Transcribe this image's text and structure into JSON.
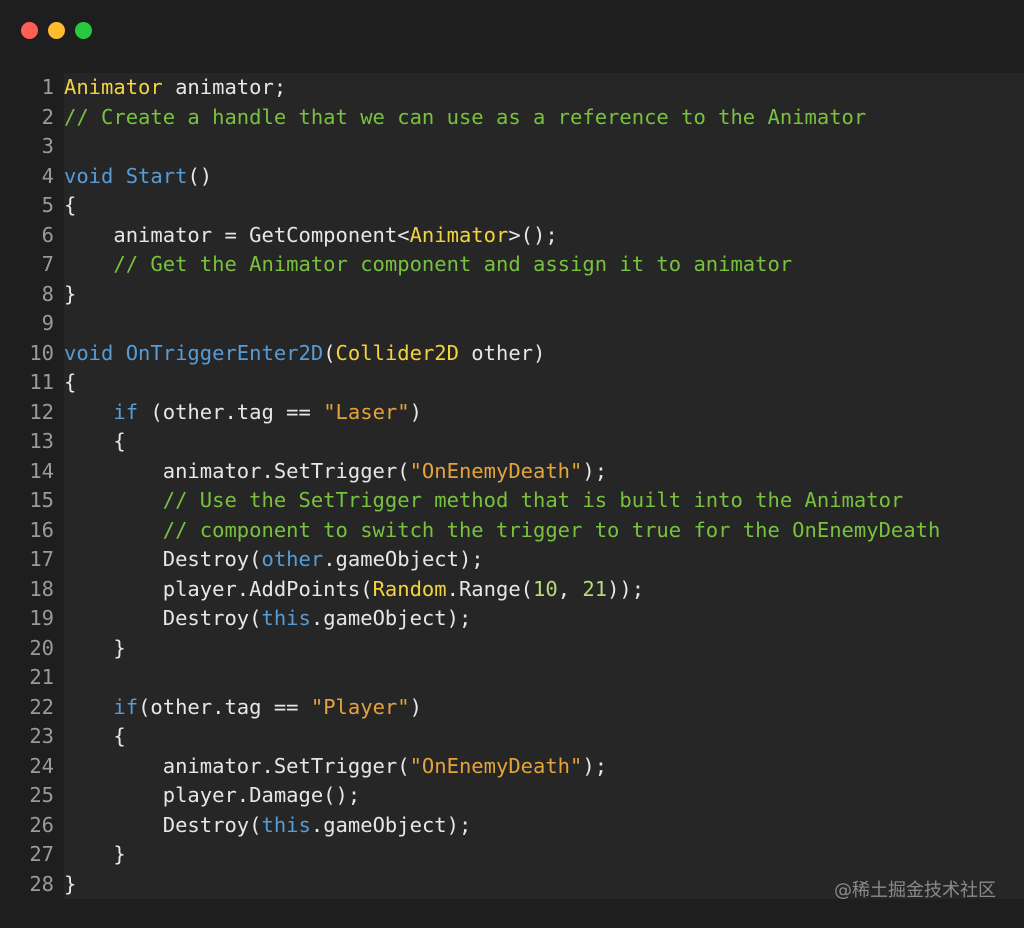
{
  "window": {
    "buttons": [
      "close",
      "minimize",
      "maximize"
    ],
    "colors": {
      "close": "#ff5f57",
      "minimize": "#febc2e",
      "maximize": "#28c840",
      "background": "#1e1e1e"
    }
  },
  "watermark": "@稀土掘金技术社区",
  "code_lines": [
    {
      "n": "1",
      "tokens": [
        [
          "ty",
          "Animator"
        ],
        [
          "pl",
          " animator;"
        ]
      ]
    },
    {
      "n": "2",
      "tokens": [
        [
          "cm",
          "// Create a handle that we can use as a reference to the Animator"
        ]
      ]
    },
    {
      "n": "3",
      "tokens": []
    },
    {
      "n": "4",
      "tokens": [
        [
          "kw",
          "void"
        ],
        [
          "pl",
          " "
        ],
        [
          "fn",
          "Start"
        ],
        [
          "pl",
          "()"
        ]
      ]
    },
    {
      "n": "5",
      "tokens": [
        [
          "pl",
          "{"
        ]
      ]
    },
    {
      "n": "6",
      "tokens": [
        [
          "pl",
          "    animator = GetComponent<"
        ],
        [
          "ty",
          "Animator"
        ],
        [
          "pl",
          ">();"
        ]
      ]
    },
    {
      "n": "7",
      "tokens": [
        [
          "cm",
          "    // Get the Animator component and assign it to animator"
        ]
      ]
    },
    {
      "n": "8",
      "tokens": [
        [
          "pl",
          "}"
        ]
      ]
    },
    {
      "n": "9",
      "tokens": []
    },
    {
      "n": "10",
      "tokens": [
        [
          "kw",
          "void"
        ],
        [
          "pl",
          " "
        ],
        [
          "fn",
          "OnTriggerEnter2D"
        ],
        [
          "pl",
          "("
        ],
        [
          "ty",
          "Collider2D"
        ],
        [
          "pl",
          " other)"
        ]
      ]
    },
    {
      "n": "11",
      "tokens": [
        [
          "pl",
          "{"
        ]
      ]
    },
    {
      "n": "12",
      "tokens": [
        [
          "pl",
          "    "
        ],
        [
          "kw",
          "if"
        ],
        [
          "pl",
          " (other.tag == "
        ],
        [
          "str",
          "\"Laser\""
        ],
        [
          "pl",
          ")"
        ]
      ]
    },
    {
      "n": "13",
      "tokens": [
        [
          "pl",
          "    {"
        ]
      ]
    },
    {
      "n": "14",
      "tokens": [
        [
          "pl",
          "        animator.SetTrigger("
        ],
        [
          "str",
          "\"OnEnemyDeath\""
        ],
        [
          "pl",
          ");"
        ]
      ]
    },
    {
      "n": "15",
      "tokens": [
        [
          "cm",
          "        // Use the SetTrigger method that is built into the Animator"
        ]
      ]
    },
    {
      "n": "16",
      "tokens": [
        [
          "cm",
          "        // component to switch the trigger to true for the OnEnemyDeath"
        ]
      ]
    },
    {
      "n": "17",
      "tokens": [
        [
          "pl",
          "        Destroy("
        ],
        [
          "kw",
          "other"
        ],
        [
          "pl",
          ".gameObject);"
        ]
      ]
    },
    {
      "n": "18",
      "tokens": [
        [
          "pl",
          "        player.AddPoints("
        ],
        [
          "ty",
          "Random"
        ],
        [
          "pl",
          ".Range("
        ],
        [
          "num",
          "10"
        ],
        [
          "pl",
          ", "
        ],
        [
          "num",
          "21"
        ],
        [
          "pl",
          "));"
        ]
      ]
    },
    {
      "n": "19",
      "tokens": [
        [
          "pl",
          "        Destroy("
        ],
        [
          "kw",
          "this"
        ],
        [
          "pl",
          ".gameObject);"
        ]
      ]
    },
    {
      "n": "20",
      "tokens": [
        [
          "pl",
          "    }"
        ]
      ]
    },
    {
      "n": "21",
      "tokens": []
    },
    {
      "n": "22",
      "tokens": [
        [
          "pl",
          "    "
        ],
        [
          "kw",
          "if"
        ],
        [
          "pl",
          "(other.tag == "
        ],
        [
          "str",
          "\"Player\""
        ],
        [
          "pl",
          ")"
        ]
      ]
    },
    {
      "n": "23",
      "tokens": [
        [
          "pl",
          "    {"
        ]
      ]
    },
    {
      "n": "24",
      "tokens": [
        [
          "pl",
          "        animator.SetTrigger("
        ],
        [
          "str",
          "\"OnEnemyDeath\""
        ],
        [
          "pl",
          ");"
        ]
      ]
    },
    {
      "n": "25",
      "tokens": [
        [
          "pl",
          "        player.Damage();"
        ]
      ]
    },
    {
      "n": "26",
      "tokens": [
        [
          "pl",
          "        Destroy("
        ],
        [
          "kw",
          "this"
        ],
        [
          "pl",
          ".gameObject);"
        ]
      ]
    },
    {
      "n": "27",
      "tokens": [
        [
          "pl",
          "    }"
        ]
      ]
    },
    {
      "n": "28",
      "tokens": [
        [
          "pl",
          "}"
        ]
      ]
    }
  ]
}
